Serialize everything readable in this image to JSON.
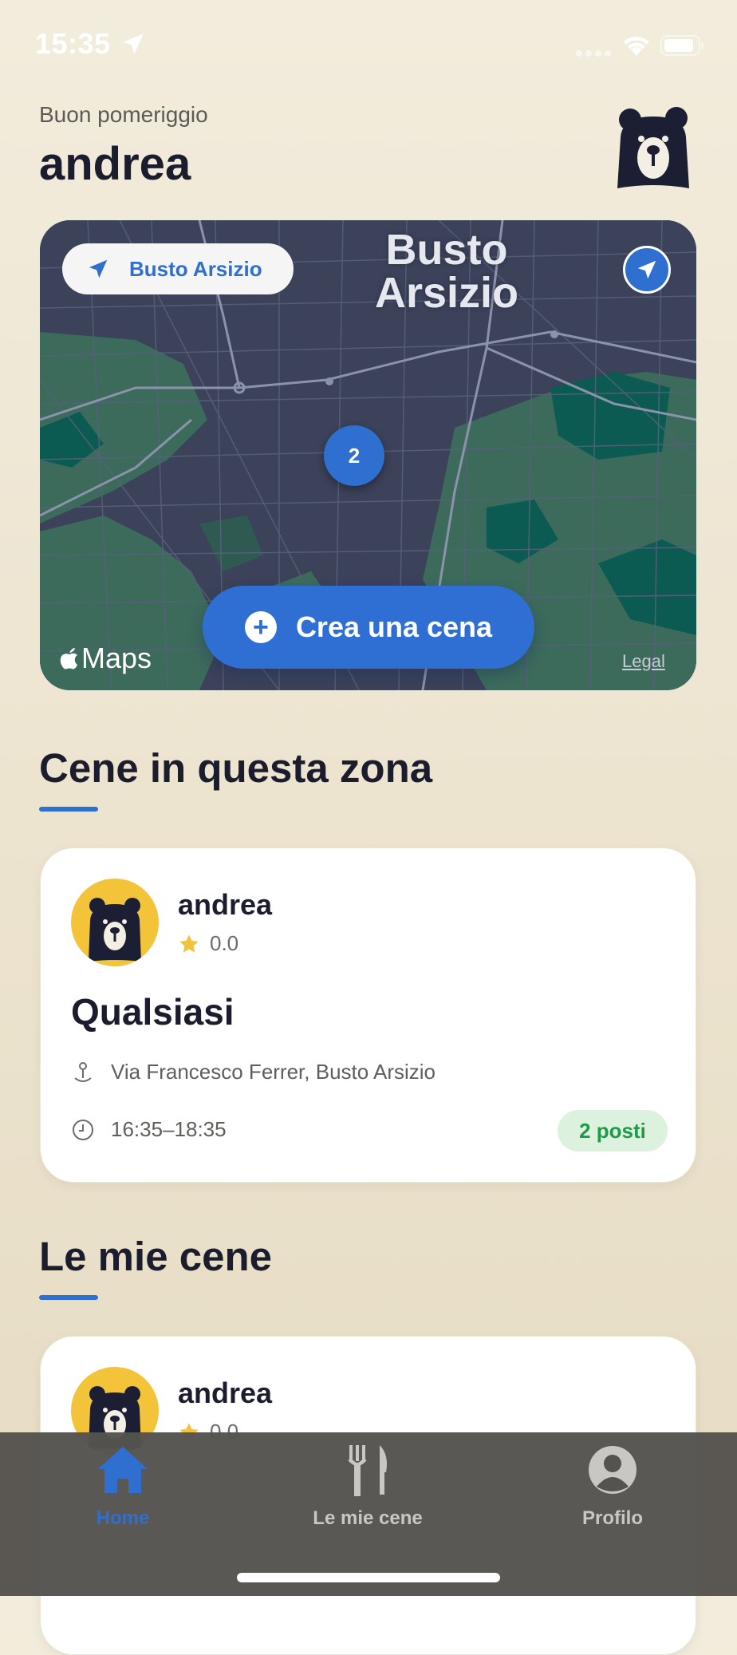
{
  "status_bar": {
    "time": "15:35"
  },
  "header": {
    "greeting": "Buon pomeriggio",
    "user_name": "andrea"
  },
  "map": {
    "city_label": "Busto Arsizio",
    "city_chip_label": "Busto Arsizio",
    "cluster_count": "2",
    "create_button_label": "Crea una cena",
    "maps_label": "Maps",
    "legal_label": "Legal"
  },
  "sections": {
    "nearby_title": "Cene in questa zona",
    "mine_title": "Le mie cene"
  },
  "nearby_dinner": {
    "host_name": "andrea",
    "rating": "0.0",
    "title": "Qualsiasi",
    "address": "Via Francesco Ferrer, Busto Arsizio",
    "time": "16:35–18:35",
    "seats": "2 posti"
  },
  "my_dinner": {
    "host_name": "andrea",
    "rating": "0.0"
  },
  "tab_bar": {
    "tabs": [
      {
        "label": "Home",
        "icon": "house-icon",
        "active": true
      },
      {
        "label": "Le mie cene",
        "icon": "fork-knife-icon",
        "active": false
      },
      {
        "label": "Profilo",
        "icon": "person-circle-icon",
        "active": false
      }
    ]
  },
  "colors": {
    "accent": "#2e6fd0",
    "avatar_bg": "#f3c43a",
    "seats_bg": "#dcf1de",
    "seats_text": "#1f9a48",
    "star": "#f3c43a",
    "tab_inactive": "#c9c7c2"
  }
}
